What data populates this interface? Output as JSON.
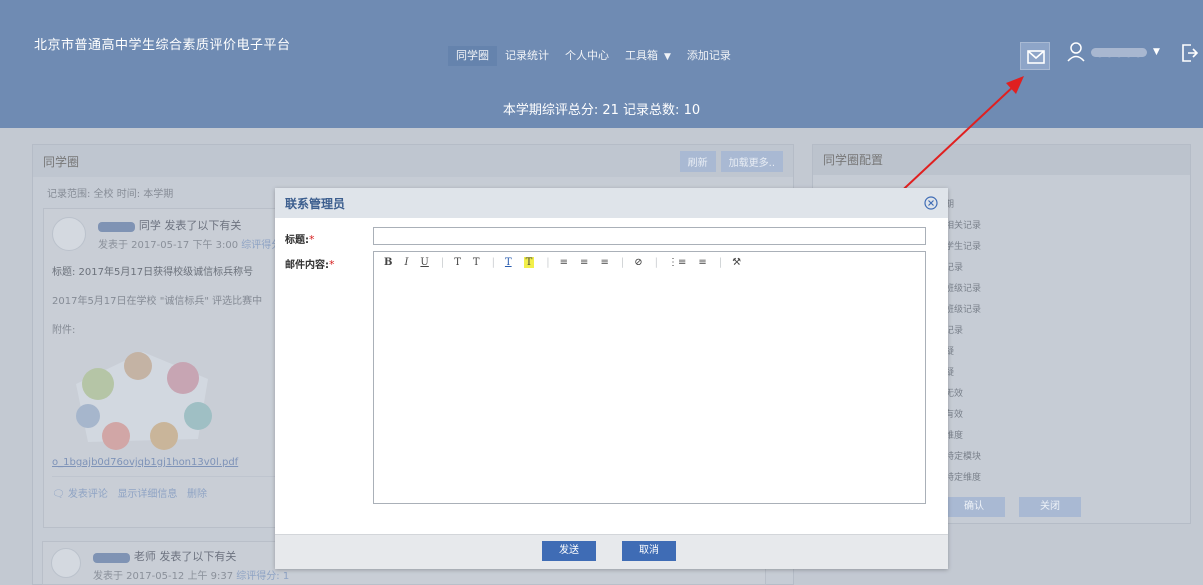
{
  "header": {
    "brand": "北京市普通高中学生综合素质评价电子平台",
    "nav": [
      {
        "label": "同学圈",
        "active": true
      },
      {
        "label": "记录统计"
      },
      {
        "label": "个人中心"
      },
      {
        "label": "工具箱"
      },
      {
        "label": "添加记录"
      }
    ],
    "summary": "本学期综评总分: 21 记录总数: 10",
    "user_name": "●●●●●"
  },
  "feed": {
    "title": "同学圈",
    "refresh": "刷新",
    "load_more": "加载更多..",
    "scope": "记录范围: 全校    时间: 本学期",
    "post1": {
      "author_blur": "●●●●",
      "head": "同学 发表了以下有关",
      "time": "发表于 2017-05-17 下午 3:00",
      "score_link": "综评得分",
      "title": "标题: 2017年5月17日获得校级诚信标兵称号",
      "body": "2017年5月17日在学校 \"诚信标兵\" 评选比赛中",
      "attach_label": "附件:",
      "file": "o_1bgajb0d76ovjqb1gj1hon13v0l.pdf",
      "actions": [
        "发表评论",
        "显示详细信息",
        "删除"
      ]
    },
    "post2": {
      "author_blur": "●●●●",
      "head": "老师 发表了以下有关",
      "time": "发表于 2017-05-12 上午 9:37",
      "score": "综评得分: 1"
    }
  },
  "config": {
    "title": "同学圈配置",
    "items": [
      "期",
      "相关记录",
      "学生记录",
      "记录",
      "班级记录",
      "班级记录",
      "记录",
      "疑",
      "疑",
      "无效",
      "有效",
      "维度",
      "特定模块",
      "特定维度"
    ],
    "confirm": "确认",
    "close": "关闭"
  },
  "modal": {
    "title": "联系管理员",
    "subject_label": "标题:",
    "content_label": "邮件内容:",
    "required_mark": "*",
    "toolbar": [
      "B",
      "I",
      "U",
      "T",
      "T",
      "T",
      "T",
      "≡",
      "≡",
      "≡",
      "⊘",
      "⋮≡",
      "≡",
      "⚒"
    ],
    "send": "发送",
    "cancel": "取消"
  },
  "colors": {
    "header": "#6f8bb3",
    "accent": "#3f6cb5",
    "arrow": "#e02020"
  }
}
